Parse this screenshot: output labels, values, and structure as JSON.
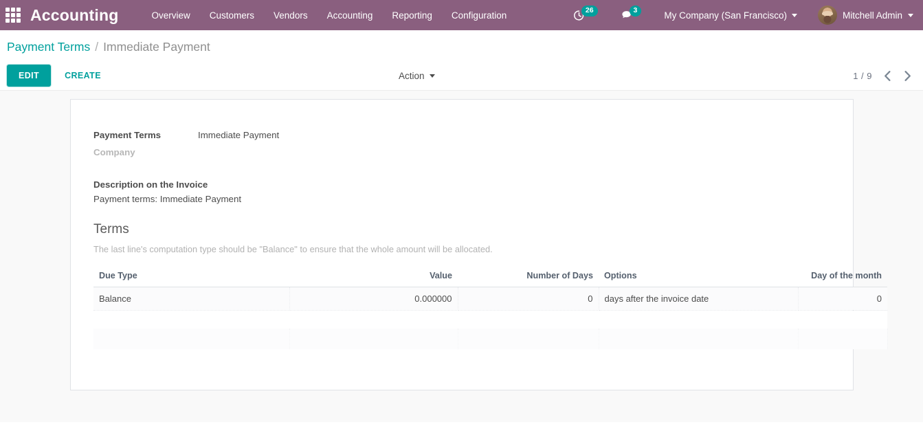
{
  "navbar": {
    "apps_icon": "apps-grid-icon",
    "brand": "Accounting",
    "menu": [
      {
        "label": "Overview"
      },
      {
        "label": "Customers"
      },
      {
        "label": "Vendors"
      },
      {
        "label": "Accounting"
      },
      {
        "label": "Reporting"
      },
      {
        "label": "Configuration"
      }
    ],
    "activity": {
      "icon": "clock-activity-icon",
      "count": "26"
    },
    "messages": {
      "icon": "message-bubble-icon",
      "count": "3"
    },
    "company": "My Company (San Francisco)",
    "user": "Mitchell Admin",
    "avatar_icon": "user-avatar",
    "colors": {
      "background": "#8a5f7f",
      "badge": "#00a09d",
      "text": "#ffffff"
    }
  },
  "breadcrumb": {
    "root": "Payment Terms",
    "separator": "/",
    "current": "Immediate Payment"
  },
  "controls": {
    "edit_label": "EDIT",
    "create_label": "CREATE",
    "action_label": "Action",
    "pager_count": "1 / 9",
    "prev_icon": "chevron-left-icon",
    "next_icon": "chevron-right-icon",
    "accent_color": "#00a09d"
  },
  "form": {
    "fields": [
      {
        "label": "Payment Terms",
        "value": "Immediate Payment"
      },
      {
        "label": "Company",
        "value": ""
      }
    ],
    "description": {
      "label": "Description on the Invoice",
      "value": "Payment terms: Immediate Payment"
    },
    "terms": {
      "title": "Terms",
      "hint": "The last line's computation type should be \"Balance\" to ensure that the whole amount will be allocated.",
      "columns": [
        {
          "label": "Due Type",
          "align": "left"
        },
        {
          "label": "Value",
          "align": "right"
        },
        {
          "label": "Number of Days",
          "align": "right"
        },
        {
          "label": "Options",
          "align": "left"
        },
        {
          "label": "Day of the month",
          "align": "right"
        }
      ],
      "rows": [
        {
          "due_type": "Balance",
          "value": "0.000000",
          "number_of_days": "0",
          "options": "days after the invoice date",
          "day_of_month": "0"
        }
      ]
    }
  }
}
